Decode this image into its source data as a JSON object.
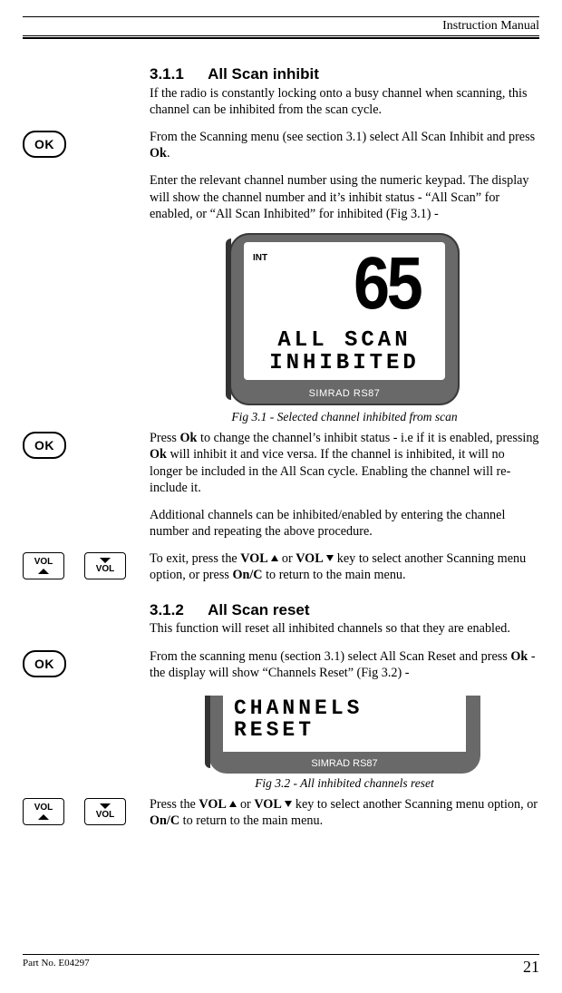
{
  "header": {
    "title": "Instruction Manual"
  },
  "footer": {
    "part": "Part No. E04297",
    "page": "21"
  },
  "sec1": {
    "num": "3.1.1",
    "title": "All Scan inhibit",
    "p1": "If the radio is constantly locking onto a busy channel when scanning, this channel can be inhibited from the scan cycle.",
    "p2a": "From the Scanning menu (see section 3.1) select All Scan Inhibit and press ",
    "p2b": ".",
    "p3": "Enter the relevant channel number using the numeric keypad. The display will show the channel number and it’s inhibit status - “All Scan” for enabled, or “All Scan Inhibited” for inhibited (Fig 3.1) -",
    "caption1": "Fig 3.1 - Selected channel inhibited from scan",
    "p4a": "Press ",
    "p4b": " to change the channel’s inhibit status - i.e if it is enabled, pressing ",
    "p4c": " will inhibit it and vice versa.  If the channel is inhibited, it will no longer be included in the All Scan cycle.  Enabling the channel will re-include it.",
    "p5": "Additional channels can be inhibited/enabled by entering the channel number and repeating the above procedure.",
    "p6a": "To exit, press the ",
    "p6b": " or ",
    "p6c": " key to select another Scanning menu option, or press ",
    "p6d": " to return to the main menu."
  },
  "sec2": {
    "num": "3.1.2",
    "title": "All Scan reset",
    "p1": "This function will reset all inhibited channels so that they are enabled.",
    "p2a": "From the scanning menu (section 3.1) select All Scan Reset and press ",
    "p2b": " - the display will show “Channels Reset” (Fig 3.2) -",
    "caption2": "Fig 3.2 - All inhibited channels reset",
    "p3a": "Press the ",
    "p3b": " or ",
    "p3c": " key to select another Scanning menu option, or ",
    "p3d": " to return to the main menu."
  },
  "labels": {
    "ok": "OK",
    "okBold": "Ok",
    "vol": "VOL",
    "volBold": "VOL",
    "onc": "On/C"
  },
  "lcd1": {
    "int": "INT",
    "num": "65",
    "line1": "ALL SCAN",
    "line2": "INHIBITED",
    "brand": "SIMRAD RS87"
  },
  "lcd2": {
    "line1": "CHANNELS",
    "line2": "RESET",
    "brand": "SIMRAD RS87"
  }
}
